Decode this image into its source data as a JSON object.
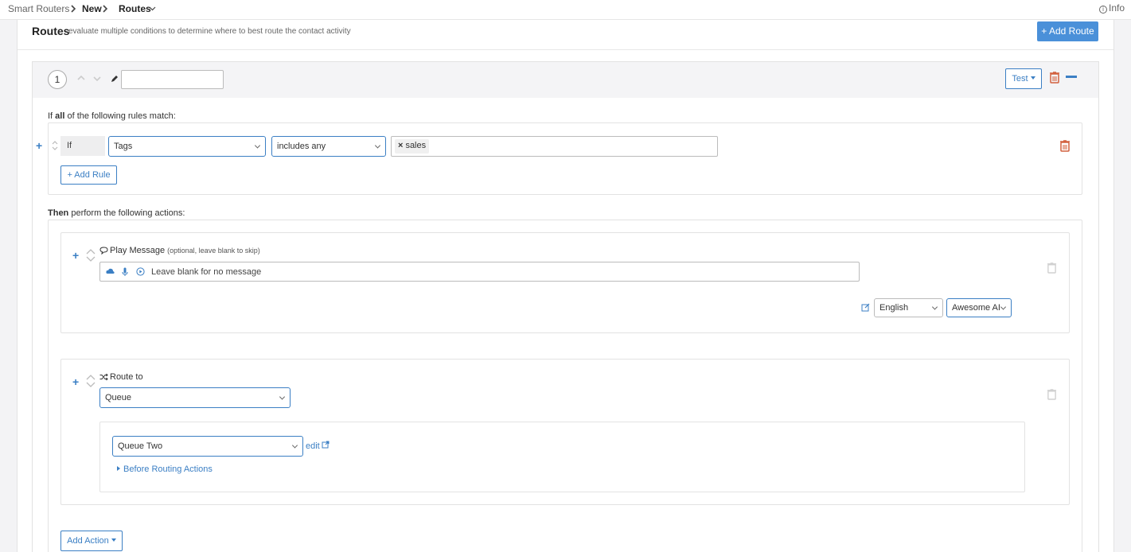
{
  "breadcrumb": {
    "items": [
      "Smart Routers",
      "New",
      "Routes"
    ],
    "info_label": "Info"
  },
  "header": {
    "title": "Routes",
    "subtitle": "evaluate multiple conditions to determine where to best route the contact activity",
    "add_route_label": "+ Add Route"
  },
  "route": {
    "number": "1",
    "name_value": "",
    "test_label": "Test",
    "rules_intro_prefix": "If ",
    "rules_intro_bold": "all",
    "rules_intro_suffix": " of the following rules match:",
    "rule": {
      "if_label": "If",
      "field_value": "Tags",
      "operator_value": "includes any",
      "tags": [
        "sales"
      ]
    },
    "add_rule_label": "+ Add Rule",
    "actions_intro_bold": "Then",
    "actions_intro_suffix": " perform the following actions:",
    "play_message": {
      "label": "Play Message",
      "hint": "(optional, leave blank to skip)",
      "placeholder": "Leave blank for no message",
      "language_value": "English",
      "voice_value": "Awesome AI"
    },
    "route_to": {
      "label": "Route to",
      "type_value": "Queue",
      "queue_value": "Queue Two",
      "edit_label": "edit",
      "before_routing_label": "Before Routing Actions"
    },
    "add_action_label": "Add Action"
  },
  "colors": {
    "accent": "#3b7fc4",
    "primary_button": "#4a90d9",
    "danger": "#d9534f"
  }
}
